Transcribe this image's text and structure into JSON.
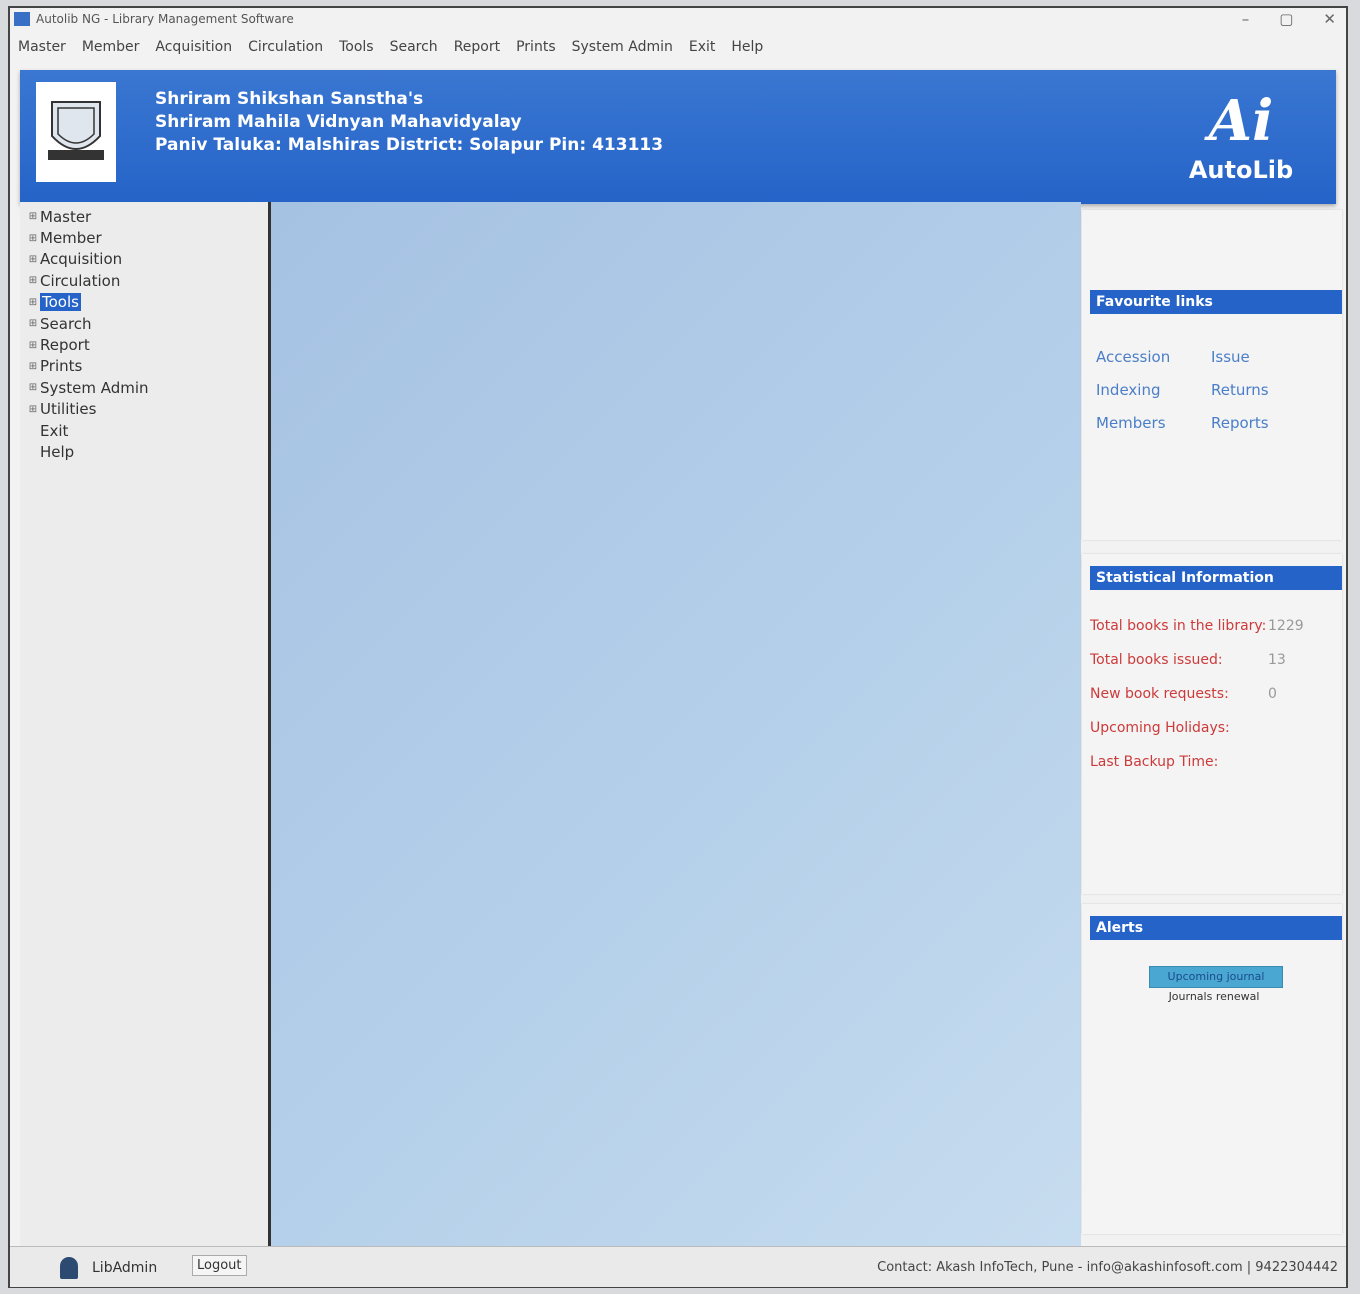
{
  "window": {
    "title": "Autolib NG - Library Management Software",
    "controls": [
      "–",
      "▢",
      "✕"
    ]
  },
  "menubar": [
    "Master",
    "Member",
    "Acquisition",
    "Circulation",
    "Tools",
    "Search",
    "Report",
    "Prints",
    "System Admin",
    "Exit",
    "Help"
  ],
  "banner": {
    "line1": "Shriram Shikshan Sanstha's",
    "line2": "Shriram Mahila Vidnyan Mahavidyalay",
    "line3": "Paniv Taluka: Malshiras  District:  Solapur Pin: 413113",
    "brand_mark": "Ai",
    "brand_name": "AutoLib"
  },
  "sidebar": {
    "items": [
      {
        "label": "Master",
        "expandable": true
      },
      {
        "label": "Member",
        "expandable": true
      },
      {
        "label": "Acquisition",
        "expandable": true
      },
      {
        "label": "Circulation",
        "expandable": true
      },
      {
        "label": "Tools",
        "expandable": true,
        "selected": true
      },
      {
        "label": "Search",
        "expandable": true
      },
      {
        "label": "Report",
        "expandable": true
      },
      {
        "label": "Prints",
        "expandable": true
      },
      {
        "label": "System Admin",
        "expandable": true
      },
      {
        "label": "Utilities",
        "expandable": true
      },
      {
        "label": "Exit",
        "expandable": false
      },
      {
        "label": "Help",
        "expandable": false
      }
    ]
  },
  "favourites": {
    "title": "Favourite links",
    "links": [
      "Accession",
      "Issue",
      "Indexing",
      "Returns",
      "Members",
      "Reports"
    ]
  },
  "stats": {
    "title": "Statistical Information",
    "rows": [
      {
        "label": "Total books in the library:",
        "value": "1229"
      },
      {
        "label": "Total books issued:",
        "value": "13"
      },
      {
        "label": "New book requests:",
        "value": "0"
      },
      {
        "label": "Upcoming Holidays:",
        "value": ""
      },
      {
        "label": "Last Backup Time:",
        "value": ""
      }
    ]
  },
  "alerts": {
    "title": "Alerts",
    "button1": "Upcoming journal",
    "button2": "Journals renewal"
  },
  "status": {
    "user": "LibAdmin",
    "logout": "Logout",
    "contact": "Contact:  Akash InfoTech, Pune  -  info@akashinfosoft.com  |  9422304442"
  },
  "colors": {
    "accent": "#2563c8",
    "main_bg": "#b6d1ea",
    "stat_label": "#cc3a3a"
  }
}
